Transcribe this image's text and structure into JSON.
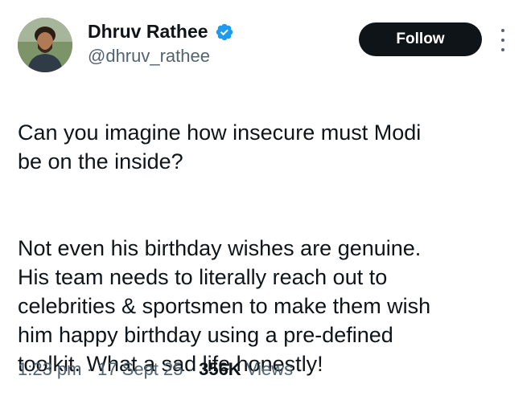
{
  "author": {
    "display_name": "Dhruv Rathee",
    "handle": "@dhruv_rathee",
    "verified": true,
    "verified_color": "#1d9bf0"
  },
  "actions": {
    "follow_label": "Follow",
    "more_icon": "more-vertical-icon"
  },
  "tweet": {
    "paragraphs": [
      "Can you imagine how insecure must Modi\nbe on the inside?",
      "Not even his birthday wishes are genuine.\nHis team needs to literally reach out to\ncelebrities & sportsmen to make them wish\nhim happy birthday using a pre-defined\ntoolkit. What a sad life honestly!"
    ]
  },
  "meta": {
    "time": "1:23 pm",
    "separator": "·",
    "date": "17 Sept 25",
    "views_count": "356K",
    "views_label": "Views"
  }
}
